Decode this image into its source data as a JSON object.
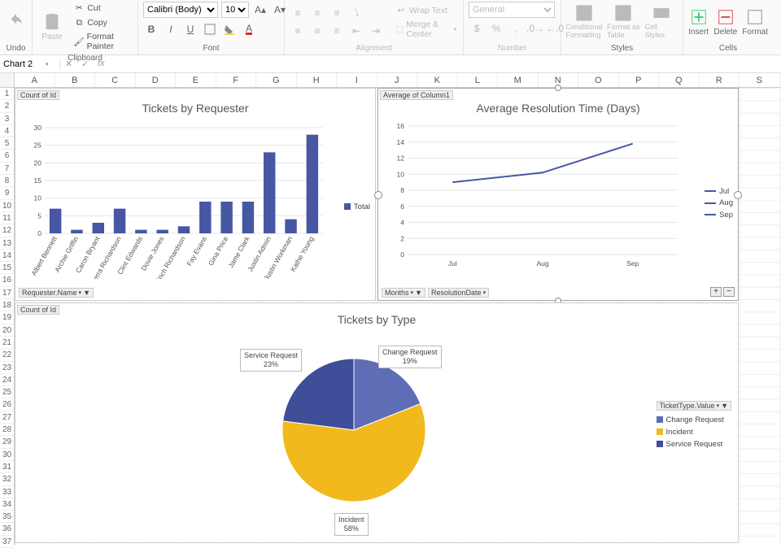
{
  "ribbon": {
    "undo": {
      "label": "Undo"
    },
    "clipboard": {
      "group": "Clipboard",
      "paste": "Paste",
      "cut": "Cut",
      "copy": "Copy",
      "painter": "Format Painter"
    },
    "font": {
      "group": "Font",
      "name": "Calibri (Body)",
      "size": "10",
      "bold": "B",
      "italic": "I",
      "underline": "U"
    },
    "alignment": {
      "group": "Alignment",
      "wrap": "Wrap Text",
      "merge": "Merge & Center"
    },
    "number": {
      "group": "Number",
      "format": "General",
      "currency": "$",
      "percent": "%",
      "comma": ","
    },
    "styles": {
      "group": "Styles",
      "cond": "Conditional Formatting",
      "table": "Format as Table",
      "cell": "Cell Styles"
    },
    "cells": {
      "group": "Cells",
      "insert": "Insert",
      "delete": "Delete",
      "format": "Format"
    }
  },
  "namebox": "Chart 2",
  "columns": [
    "A",
    "B",
    "C",
    "D",
    "E",
    "F",
    "G",
    "H",
    "I",
    "J",
    "K",
    "L",
    "M",
    "N",
    "O",
    "P",
    "Q",
    "R",
    "S"
  ],
  "chart_data": [
    {
      "type": "bar",
      "title": "Tickets by Requester",
      "pivot_value_label": "Count of Id",
      "pivot_axis_label": "Requester.Name",
      "legend": [
        "Total"
      ],
      "ylim": [
        0,
        30
      ],
      "yticks": [
        0,
        5,
        10,
        15,
        20,
        25,
        30
      ],
      "categories": [
        "Albert Bennett",
        "Archie Griffin",
        "Caron Bryant",
        "Cierra Richardson",
        "Clint Edwards",
        "Dovie Jones",
        "Erich Richardson",
        "Fay Evans",
        "Gina Price",
        "Jame Clark",
        "Justin Admin",
        "Justin Workman",
        "Kathe Young"
      ],
      "values": [
        7,
        1,
        3,
        7,
        1,
        1,
        2,
        9,
        9,
        9,
        23,
        4,
        28
      ]
    },
    {
      "type": "line",
      "title": "Average Resolution Time (Days)",
      "pivot_value_label": "Average of Column1",
      "pivot_axis_labels": [
        "Months",
        "ResolutionDate"
      ],
      "legend": [
        "Jul",
        "Aug",
        "Sep"
      ],
      "ylim": [
        0,
        16
      ],
      "yticks": [
        0,
        2,
        4,
        6,
        8,
        10,
        12,
        14,
        16
      ],
      "categories": [
        "Jul",
        "Aug",
        "Sep"
      ],
      "values": [
        9,
        10.2,
        13.8
      ]
    },
    {
      "type": "pie",
      "title": "Tickets by Type",
      "pivot_value_label": "Count of Id",
      "pivot_field_label": "TicketType.Value",
      "series": [
        {
          "name": "Change Request",
          "pct": 19,
          "color": "#5f6db6"
        },
        {
          "name": "Incident",
          "pct": 58,
          "color": "#f1b91c"
        },
        {
          "name": "Service Request",
          "pct": 23,
          "color": "#3e4e98"
        }
      ],
      "labels": {
        "change": "Change Request\n19%",
        "incident": "Incident\n58%",
        "service": "Service Request\n23%"
      }
    }
  ]
}
